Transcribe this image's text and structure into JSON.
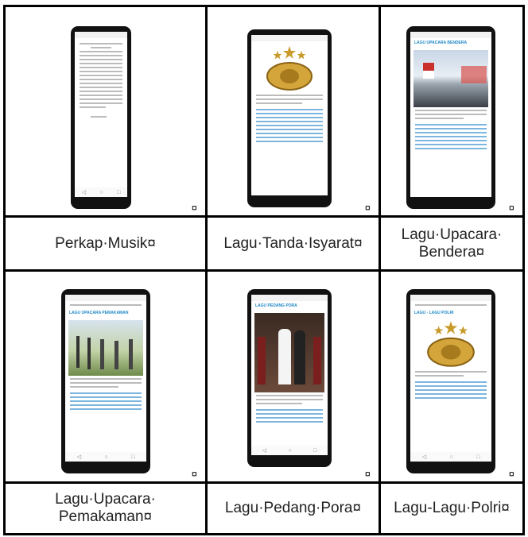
{
  "captions": {
    "perkap_musik": "Perkap·Musik¤",
    "lagu_tanda_isyarat": "Lagu·Tanda·Isyarat¤",
    "lagu_upacara_bendera": "Lagu·Upacara·\nBendera¤",
    "lagu_upacara_pemakaman": "Lagu·Upacara·\nPemakaman¤",
    "lagu_pedang_pora": "Lagu·Pedang·Pora¤",
    "lagu_lagu_polri": "Lagu-Lagu·Polri¤"
  },
  "cell_mark": "¤",
  "screens": {
    "upacara_bendera_title": "LAGU UPACARA BENDERA",
    "upacara_pemakaman_title": "LAGU UPACARA PEMAKAMAN",
    "pedang_pora_title": "LAGU PEDANG PORA",
    "lagu_polri_title": "LAGU - LAGU POLRI"
  },
  "icons": {
    "nav_back": "◁",
    "nav_home": "○",
    "nav_recent": "□"
  }
}
